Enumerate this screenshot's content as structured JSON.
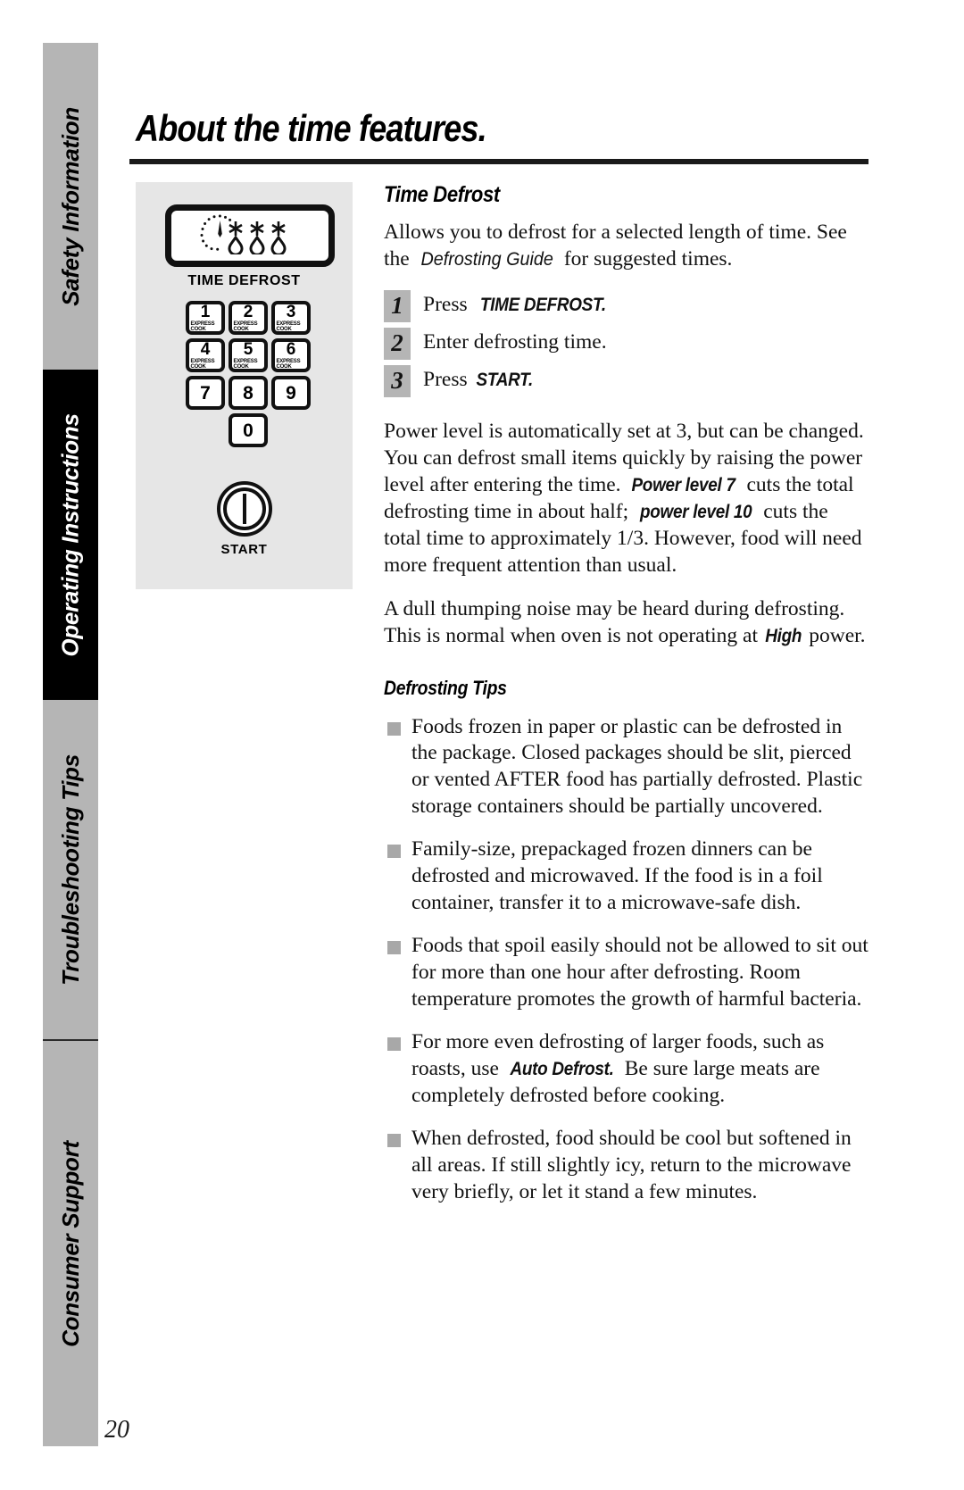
{
  "page": {
    "number": "20",
    "title": "About the time features."
  },
  "sidebar": {
    "tabs": [
      {
        "label": "Safety Information",
        "state": "inactive"
      },
      {
        "label": "Operating Instructions",
        "state": "active"
      },
      {
        "label": "Troubleshooting Tips",
        "state": "inactive"
      },
      {
        "label": "Consumer Support",
        "state": "inactive"
      }
    ]
  },
  "control_panel": {
    "defrost_key_label": "TIME DEFROST",
    "defrost_key_icon": "clock-dial-snowflakes-droplets-icon",
    "keypad": [
      {
        "num": "1",
        "sub": "EXPRESS COOK"
      },
      {
        "num": "2",
        "sub": "EXPRESS COOK"
      },
      {
        "num": "3",
        "sub": "EXPRESS COOK"
      },
      {
        "num": "4",
        "sub": "EXPRESS COOK"
      },
      {
        "num": "5",
        "sub": "EXPRESS COOK"
      },
      {
        "num": "6",
        "sub": "EXPRESS COOK"
      },
      {
        "num": "7",
        "sub": ""
      },
      {
        "num": "8",
        "sub": ""
      },
      {
        "num": "9",
        "sub": ""
      },
      {
        "num": "0",
        "sub": ""
      }
    ],
    "start_label": "START",
    "start_icon": "power-circle-icon"
  },
  "main": {
    "section_heading": "Time Defrost",
    "intro_part1": "Allows you to defrost for a selected length of time. See the ",
    "intro_italic": "Defrosting Guide",
    "intro_part2": " for suggested times.",
    "steps": [
      {
        "num": "1",
        "text_before": "Press ",
        "text_bold": "TIME DEFROST.",
        "text_after": ""
      },
      {
        "num": "2",
        "text_before": "Enter defrosting time.",
        "text_bold": "",
        "text_after": ""
      },
      {
        "num": "3",
        "text_before": "Press ",
        "text_bold": "START.",
        "text_after": ""
      }
    ],
    "power_paragraph": {
      "part1": "Power level is automatically set at 3, but can be changed. You can defrost small items quickly by raising the power level after entering the time. ",
      "bold1": "Power level 7",
      "part2": " cuts the total defrosting time in about half; ",
      "bold2": "power level 10",
      "part3": " cuts the total time to approximately 1/3. However, food will need more frequent attention than usual."
    },
    "noise_paragraph": {
      "part1": "A dull thumping noise may be heard during defrosting. This is normal when oven is not operating at ",
      "bold1": "High",
      "part2": " power."
    },
    "tips_heading": "Defrosting Tips",
    "tips": [
      {
        "part1": "Foods frozen in paper or plastic can be defrosted in the package. Closed packages should be slit, pierced or vented AFTER food has partially defrosted. Plastic storage containers should be partially uncovered.",
        "bold1": "",
        "part2": ""
      },
      {
        "part1": "Family-size, prepackaged frozen dinners can be defrosted and microwaved. If the food is in a foil container, transfer it to a microwave-safe dish.",
        "bold1": "",
        "part2": ""
      },
      {
        "part1": "Foods that spoil easily should not be allowed to sit out for more than one hour after defrosting. Room temperature promotes the growth of harmful bacteria.",
        "bold1": "",
        "part2": ""
      },
      {
        "part1": "For more even defrosting of larger foods, such as roasts, use ",
        "bold1": "Auto Defrost.",
        "part2": " Be sure large meats are completely defrosted before cooking."
      },
      {
        "part1": "When defrosted, food should be cool but softened in all areas. If still slightly icy, return to the microwave very briefly, or let it stand a few minutes.",
        "bold1": "",
        "part2": ""
      }
    ]
  },
  "colors": {
    "tab_gray": "#b5b5b5",
    "tab_active": "#000000",
    "panel_bg": "#e6e6e6",
    "bullet": "#a8a8a8",
    "step_box": "#b5b5b5"
  }
}
